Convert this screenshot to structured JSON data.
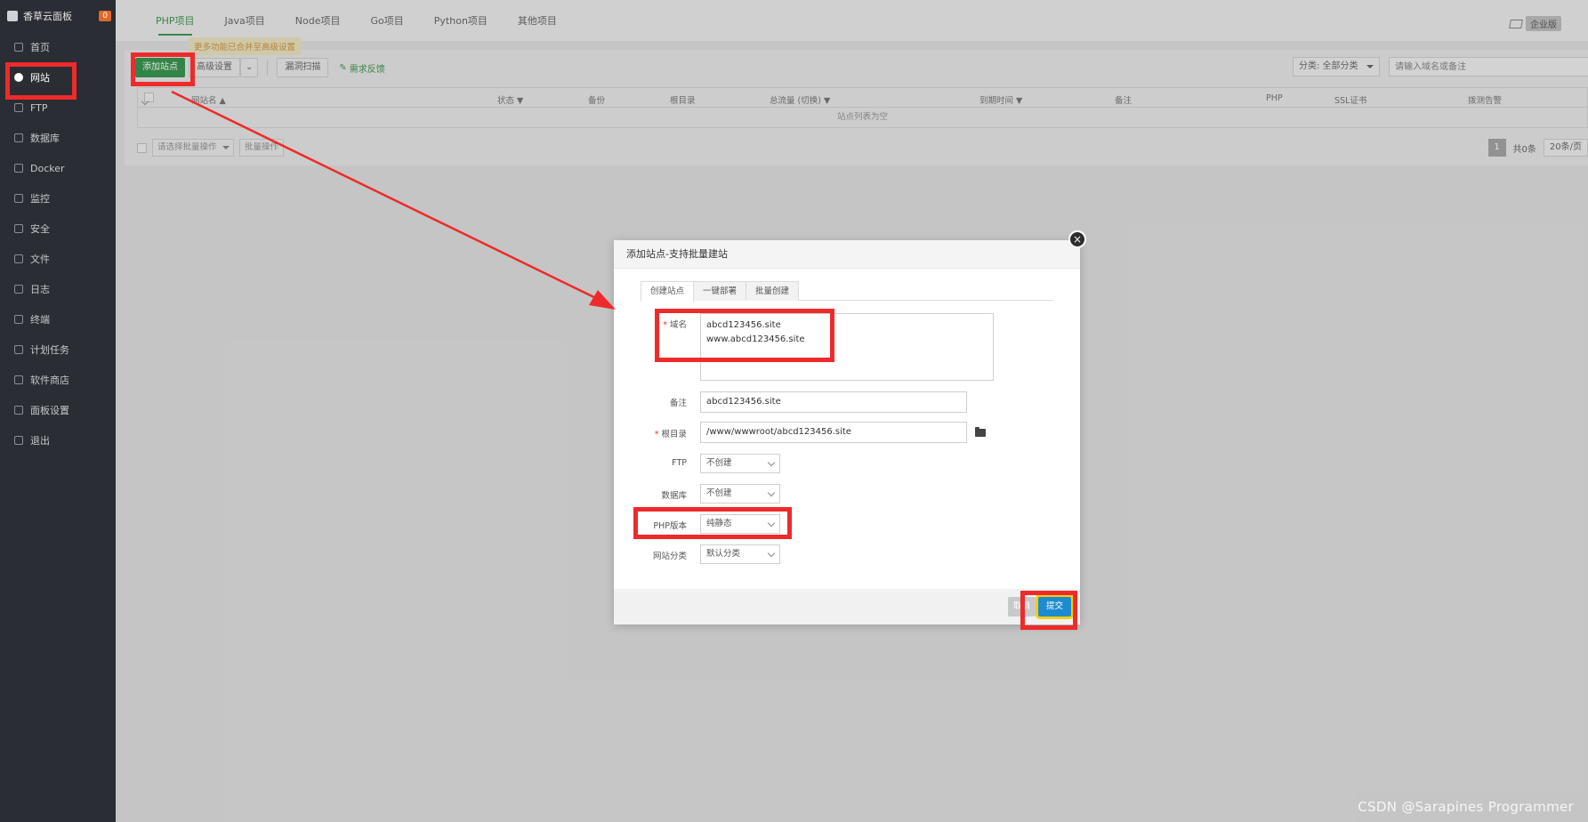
{
  "sidebar": {
    "brand": "香草云面板",
    "badge": "0",
    "items": [
      {
        "label": "首页",
        "icon": "home-icon"
      },
      {
        "label": "网站",
        "icon": "globe-icon"
      },
      {
        "label": "FTP",
        "icon": "ftp-icon"
      },
      {
        "label": "数据库",
        "icon": "database-icon"
      },
      {
        "label": "Docker",
        "icon": "docker-icon"
      },
      {
        "label": "监控",
        "icon": "monitor-icon"
      },
      {
        "label": "安全",
        "icon": "shield-icon"
      },
      {
        "label": "文件",
        "icon": "folder-icon"
      },
      {
        "label": "日志",
        "icon": "log-icon"
      },
      {
        "label": "终端",
        "icon": "terminal-icon"
      },
      {
        "label": "计划任务",
        "icon": "calendar-icon"
      },
      {
        "label": "软件商店",
        "icon": "store-icon"
      },
      {
        "label": "面板设置",
        "icon": "gear-icon"
      },
      {
        "label": "退出",
        "icon": "logout-icon"
      }
    ]
  },
  "topbar": {
    "tabs": [
      "PHP项目",
      "Java项目",
      "Node项目",
      "Go项目",
      "Python项目",
      "其他项目"
    ],
    "enterprise_label": "企业版"
  },
  "toolbar": {
    "add_site": "添加站点",
    "tooltip": "更多功能已合并至高级设置",
    "advanced": "高级设置",
    "vuln_scan": "漏洞扫描",
    "feedback": "需求反馈",
    "category": "分类: 全部分类",
    "search_placeholder": "请输入域名或备注"
  },
  "table": {
    "headers": [
      "网站名 ▲",
      "状态 ▼",
      "备份",
      "根目录",
      "总流量 (切换) ▼",
      "到期时间 ▼",
      "备注",
      "PHP",
      "SSL证书",
      "拨测告警"
    ],
    "empty": "站点列表为空"
  },
  "bottom": {
    "batch_select": "请选择批量操作",
    "batch_btn": "批量操作",
    "page": "1",
    "total": "共0条",
    "per_page": "20条/页"
  },
  "modal": {
    "title": "添加站点-支持批量建站",
    "tabs": [
      "创建站点",
      "一键部署",
      "批量创建"
    ],
    "domain_label": "域名",
    "domain_lines": [
      "abcd123456.site",
      "www.abcd123456.site"
    ],
    "remark_label": "备注",
    "remark_value": "abcd123456.site",
    "root_label": "根目录",
    "root_value": "/www/wwwroot/abcd123456.site",
    "ftp_label": "FTP",
    "ftp_value": "不创建",
    "db_label": "数据库",
    "db_value": "不创建",
    "php_label": "PHP版本",
    "php_value": "纯静态",
    "category_label": "网站分类",
    "category_value": "默认分类",
    "cancel": "取消",
    "submit": "提交"
  },
  "watermark": "CSDN @Sarapines Programmer",
  "colors": {
    "accent_green": "#1f8a3a",
    "annotation_red": "#ee2a2a",
    "submit_blue": "#1e8bd0"
  }
}
